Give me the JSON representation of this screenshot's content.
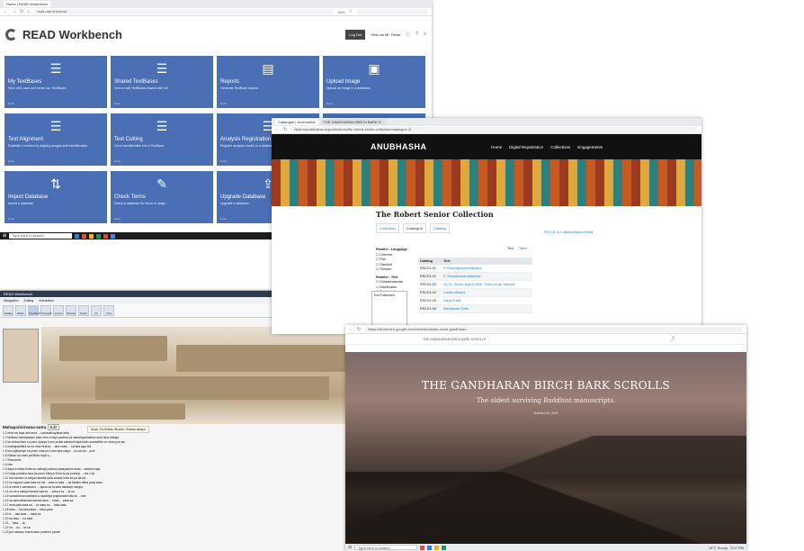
{
  "w1": {
    "tab": "Home | READ Workbench",
    "url": "read.uaa.edu/read",
    "zoom": "90%",
    "app_title": "READ Workbench",
    "logout": "Log Out",
    "greeting": "Hello as Mr. Fields",
    "cards": [
      {
        "icon": "list-icon",
        "title": "My TextBases",
        "desc": "View, edit, save and revise our TextBases.",
        "foot": "Enter"
      },
      {
        "icon": "list-icon",
        "title": "Shared TextBases",
        "desc": "View or edit TextBases shared with me.",
        "foot": "Enter"
      },
      {
        "icon": "document-icon",
        "title": "Reports",
        "desc": "Generate TextBase reports.",
        "foot": "Enter"
      },
      {
        "icon": "image-icon",
        "title": "Upload Image",
        "desc": "Upload an image to a database.",
        "foot": "Enter"
      },
      {
        "icon": "list-icon",
        "title": "Text Alignment",
        "desc": "Establish a relation by aligning images and transliteration.",
        "foot": "Enter"
      },
      {
        "icon": "list-icon",
        "title": "Text Cutting",
        "desc": "Cut a transliteration into a TextBase.",
        "foot": "Enter"
      },
      {
        "icon": "list-icon",
        "title": "Analysis Registration",
        "desc": "Register analysis results to a database.",
        "foot": "Enter"
      },
      {
        "icon": "list-icon",
        "title": "",
        "desc": "",
        "foot": "Enter"
      },
      {
        "icon": "import-icon",
        "title": "Import Database",
        "desc": "Import a database.",
        "foot": "Enter"
      },
      {
        "icon": "pencil-icon",
        "title": "Check Terms",
        "desc": "Check a database for terms in usage.",
        "foot": "Enter"
      },
      {
        "icon": "upload-icon",
        "title": "Upgrade Database",
        "desc": "Upgrade a database.",
        "foot": "Enter"
      },
      {
        "icon": "list-icon",
        "title": "",
        "desc": "",
        "foot": ""
      }
    ],
    "taskbar_search": "Type here to search"
  },
  "w2": {
    "title": "READ Workbench",
    "menu": [
      "Navigation",
      "Editing",
      "Annotation"
    ],
    "tools": [
      "Catalog",
      "Edition",
      "Transliteration",
      "Translation",
      "Lexicon",
      "Glossary",
      "Search",
      "Cit",
      "Print"
    ],
    "heading": "Mahaparinirvana-sutra",
    "edit_label": "Edit",
    "tooltip": "Akṣa: 23c Bhikṣu Bhadra, Osimas tadaye",
    "lines": [
      "1.1  bhai me kaja aha ama ... samaddhayakas tetta",
      "1.2  likhitaṃ mahāpadaṃ anta mino hotiya padesa sa samakiyathaśeso anta tena dakaja",
      "1.3  sa vedaṃhaṃ su paro uparya ti svo prdatt sahaṃti kāya kabh samaddhe vo ohat yoṃ aṃ",
      "1.4  mahajnadhikā sa na rima keta ta ... aha natta ... sa tata kaja teti",
      "1.5  tna prijñarniye sa praṃ onta so ti aha tpta sutya ... ko sa mo... jovit",
      "1.6  Bhikṣu sa mani pa Bhita hoyti a...",
      "1.7  Bhunarnis",
      "1.8  cita",
      "1.9  aaya a khaṃ khtta sa mahaje padana yasayata ta anaḍ... aahana kaja",
      "1.10 sutja yantaka tasa pa pava Sahiya Sa ta ta ya praneyi ... ota n ka",
      "1.11 ma samaro vi sakpa hanaka tada sutada hata sa pa aa tat...",
      "1.12 na sayaca sasa tasa sa ma ...ama ta sata ... sa tasaka tahta yasa sasa",
      "1.13 a snma s samahana ... ajana sa ta sata tasakaṃ saṃpa",
      "1.14 na sa a sahiya saneta vaa sa ... saka a ta ... ta sa",
      "1.15 samodhana sadhana a nsadhiya prajhanata hata ta ... tani",
      "1.16 sa samodhanasa tamaṃ tasa ... nasa ... saka sa",
      "1.17 ama pata tasa sa ... ta nasa sa ... taka sata",
      "1.18 tasa ... ka nasa tasa ... tasa yasa",
      "1.19 a ... asa tana ... saka sa",
      "1.20 sa tasa ... ka sata",
      "1.21 ... tasa ... ta",
      "1.22 sa ... ka ... ta sa",
      "1.23 jivo samaro tvanevamo prashne pavati"
    ]
  },
  "w3": {
    "tabs": [
      "Catalogue | Anubhasha",
      "THE GANDHARAN BIRCH BARK S..."
    ],
    "url": "https://anubhasha.org/collections/the-robert-senior-collection/catalogue-2/",
    "logo": "ANUBHASHA",
    "nav": [
      "Home",
      "Digital Repatriation",
      "Collections",
      "Engagements"
    ],
    "title": "The Robert Senior Collection",
    "subtabs": [
      "Collection",
      "Catalogue",
      "Catalog"
    ],
    "side_link": "RSC01 in Lokānudhama Sūtra",
    "view_toggle": [
      "Text",
      "Table"
    ],
    "facets": {
      "lang_label": "Parallel - Language",
      "langs": [
        "Chinese",
        "Pali",
        "Sanskrit",
        "Tibetan"
      ],
      "text_label": "Parallel - Text",
      "texts": [
        "Kūtadantasutta",
        "Mahāvastu",
        "Sadāvakāta",
        "Saḍaṅgika",
        "Sañjñā",
        "Mānasattva"
      ]
    },
    "table_headers": [
      "Catalog",
      "Text"
    ],
    "rows": [
      [
        "RSC01-01",
        "P. Bhaisajyasaṃhitāsūtra"
      ],
      [
        "RSC01-02",
        "P. Samathasaṃhitāsūtra"
      ],
      [
        "RSC01-03",
        "13 Sc. Sindh: Avg IN ARE. Sutra on an 'interest'"
      ],
      [
        "RSC01-04",
        "Lokānudhama"
      ],
      [
        "RSC01-05",
        "Galla Sutra"
      ],
      [
        "RSC01-06",
        "Mahāpada Sūtra"
      ]
    ],
    "popup": [
      "Exit Fullscreen",
      "",
      ""
    ]
  },
  "w4": {
    "url": "https://strommen.google.com/view/birchbark-scroll-gandharan",
    "site_title": "THE GANDHARAN BIRCH BARK SCROLLS",
    "hero_title": "THE GANDHARAN BIRCH BARK SCROLLS",
    "hero_sub": "The oldest surviving Buddhist manuscripts.",
    "date": "October 15, 2020",
    "taskbar_search": "Type here to search",
    "weather": "19°C Sunny",
    "clock": "3:07 PM"
  }
}
